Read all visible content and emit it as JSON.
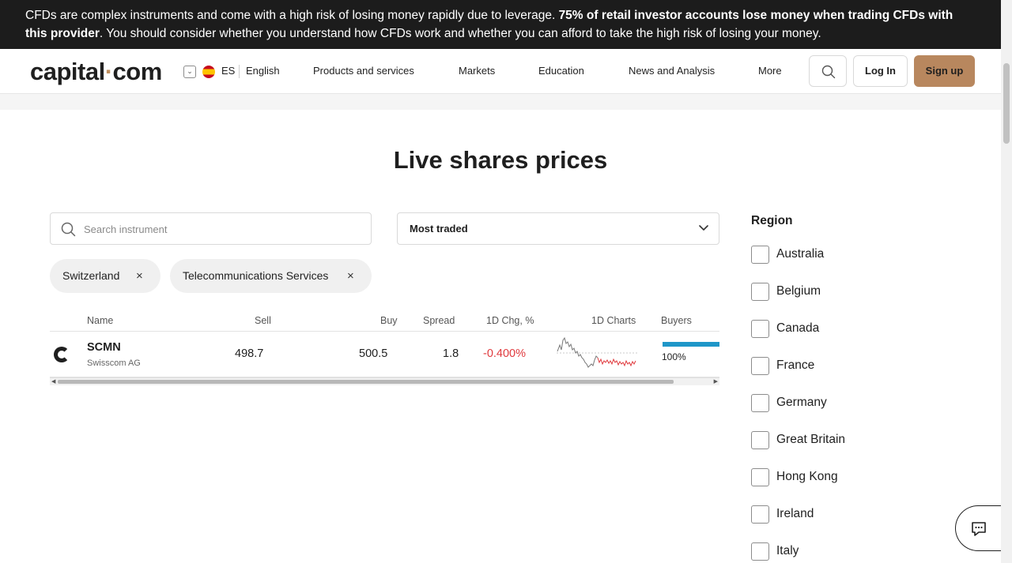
{
  "risk_banner": {
    "text_start": "CFDs are complex instruments and come with a high risk of losing money rapidly due to leverage. ",
    "text_bold": "75% of retail investor accounts lose money when trading CFDs with this provider",
    "text_end": ". You should consider whether you understand how CFDs work and whether you can afford to take the high risk of losing your money."
  },
  "header": {
    "logo_left": "capital",
    "logo_dot": "·",
    "logo_right": "com",
    "lang_dropdown": "⌄",
    "lang_code": "ES",
    "lang_name": "English",
    "nav": [
      "Products and services",
      "Markets",
      "Education",
      "News and Analysis",
      "More"
    ],
    "login_label": "Log In",
    "signup_label": "Sign up"
  },
  "main": {
    "title": "Live shares prices",
    "search_placeholder": "Search instrument",
    "sort_value": "Most traded",
    "chips": [
      {
        "label": "Switzerland"
      },
      {
        "label": "Telecommunications Services"
      }
    ],
    "chip_close": "×"
  },
  "table": {
    "headers": {
      "name": "Name",
      "sell": "Sell",
      "buy": "Buy",
      "spread": "Spread",
      "change": "1D Chg, %",
      "charts": "1D Charts",
      "buyers": "Buyers"
    },
    "rows": [
      {
        "symbol": "SCMN",
        "company": "Swisscom AG",
        "sell": "498.7",
        "buy": "500.5",
        "spread": "1.8",
        "change": "-0.400%",
        "buyers_pct": "100%",
        "buyers_fraction": 1.0
      }
    ]
  },
  "region": {
    "title": "Region",
    "items": [
      "Australia",
      "Belgium",
      "Canada",
      "France",
      "Germany",
      "Great Britain",
      "Hong Kong",
      "Ireland",
      "Italy"
    ]
  },
  "colors": {
    "banner_bg": "#1c1c1c",
    "signup_bg": "#b8875e",
    "negative": "#e03a3e",
    "buyers_bar": "#1e96c8"
  },
  "icons": {
    "search": "search-icon",
    "chevron": "chevron-down-icon",
    "chat": "chat-icon",
    "close": "close-icon"
  }
}
